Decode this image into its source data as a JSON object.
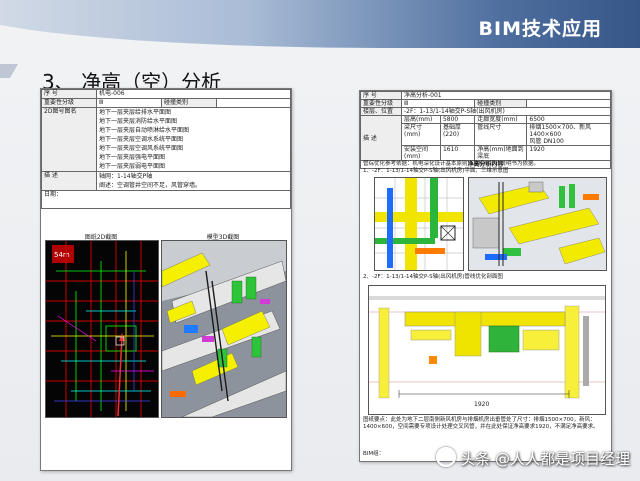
{
  "header": {
    "title": "BIM技术应用"
  },
  "section": {
    "title": "3、 净高（空）分析"
  },
  "sheet_left": {
    "row_serial": {
      "label": "序 号",
      "value": "机电-006"
    },
    "row_level": {
      "label": "重要性分级",
      "value": "Ⅲ",
      "type_label": "碰撞类别"
    },
    "drawings_label": "2D图号图名",
    "drawings": [
      "地下一层夹层给排水平面图",
      "地下一层夹层消防给水平面图",
      "地下一层夹层自动喷淋给水平面图",
      "地下一层夹层空调水系统平面图",
      "地下一层夹层空调风系统平面图",
      "地下一层夹层强电平面图",
      "地下一层夹层弱电平面图"
    ],
    "desc_label": "描 述",
    "desc": [
      "轴网：1-14轴交P轴",
      "阐述：空调管井空间不足，风管穿墙。"
    ],
    "date_label": "日期：",
    "img1_caption": "图纸2D截图",
    "img2_caption": "模型3D截图"
  },
  "sheet_right": {
    "serial_label": "序 号",
    "serial_value": "净高分析-001",
    "level_label": "重要性分级",
    "level_value": "Ⅲ",
    "type_label": "碰撞类别",
    "loc_label": "楼层、位置",
    "loc_value": "-2F：1-13/1-14轴交P-S轴(出风机房)",
    "desc_label": "描 述",
    "cells": [
      "层高(mm)",
      "5800",
      "走廊宽度(mm)",
      "6500",
      "梁尺寸(mm)",
      "基础厚(220)",
      "管线尺寸",
      "排烟1500×700、新风1400×600",
      "风管",
      "DN100",
      "安装空间(mm)",
      "1610",
      "净高(mm)地面到梁底",
      "1920"
    ],
    "section_title": "净高分析内容",
    "text_a": "管综优化参考依据：机电深化设计基本原则以及机电设计说明书为依据。",
    "text_b": "1、-2F：1-13/1-14轴交P-S轴(出风机房)平面、三维示意图",
    "text_c": "2、-2F：1-13/1-14轴交P-S轴(出风机房)管线优化剖面图",
    "text_d": "图纸要点：此处为地下二层南侧新风机房与排烟机房出垂管处了尺寸：排烟1500×700，新风：1400×600，空间需要专项设计处理交叉风管，并在此处保证净高要求1920，不满足净高要求。",
    "footer": "BIM组："
  },
  "watermark": "头条 @人人都是项目经理"
}
